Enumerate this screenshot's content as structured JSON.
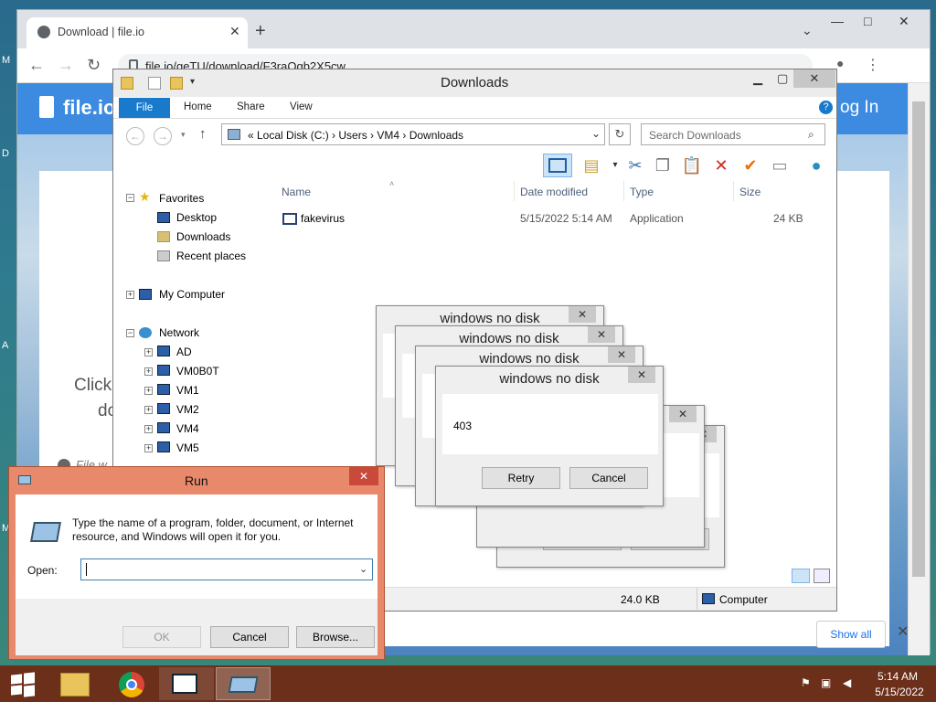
{
  "desktop": {
    "edge_labels": [
      "M",
      "D",
      "A",
      "M"
    ]
  },
  "chrome": {
    "tab_title": "Download | file.io",
    "address": "file.io/geTU/download/F3raOgb2X5cw",
    "page": {
      "brand": "file.io",
      "login": "og In",
      "click_text": "Click",
      "click_text_2": "do",
      "file_note": "File w",
      "show_all": "Show all"
    }
  },
  "explorer": {
    "title": "Downloads",
    "ribbon_tabs": [
      "File",
      "Home",
      "Share",
      "View"
    ],
    "breadcrumb": "«  Local Disk (C:)  ›  Users  ›  VM4  ›  Downloads",
    "search_placeholder": "Search Downloads",
    "nav": {
      "favorites": "Favorites",
      "favorites_items": [
        "Desktop",
        "Downloads",
        "Recent places"
      ],
      "my_computer": "My Computer",
      "network": "Network",
      "network_items": [
        "AD",
        "VM0B0T",
        "VM1",
        "VM2",
        "VM4",
        "VM5"
      ]
    },
    "columns": [
      "Name",
      "Date modified",
      "Type",
      "Size"
    ],
    "files": [
      {
        "name": "fakevirus",
        "date": "5/15/2022 5:14 AM",
        "type": "Application",
        "size": "24 KB"
      }
    ],
    "status": {
      "size": "24.0 KB",
      "location": "Computer"
    }
  },
  "dialogs": {
    "title": "windows no disk",
    "message": "403",
    "retry": "Retry",
    "cancel": "Cancel"
  },
  "run": {
    "title": "Run",
    "description": "Type the name of a program, folder, document, or Internet resource, and Windows will open it for you.",
    "open_label": "Open:",
    "open_value": "",
    "ok": "OK",
    "cancel": "Cancel",
    "browse": "Browse..."
  },
  "taskbar": {
    "time": "5:14 AM",
    "date": "5/15/2022"
  }
}
